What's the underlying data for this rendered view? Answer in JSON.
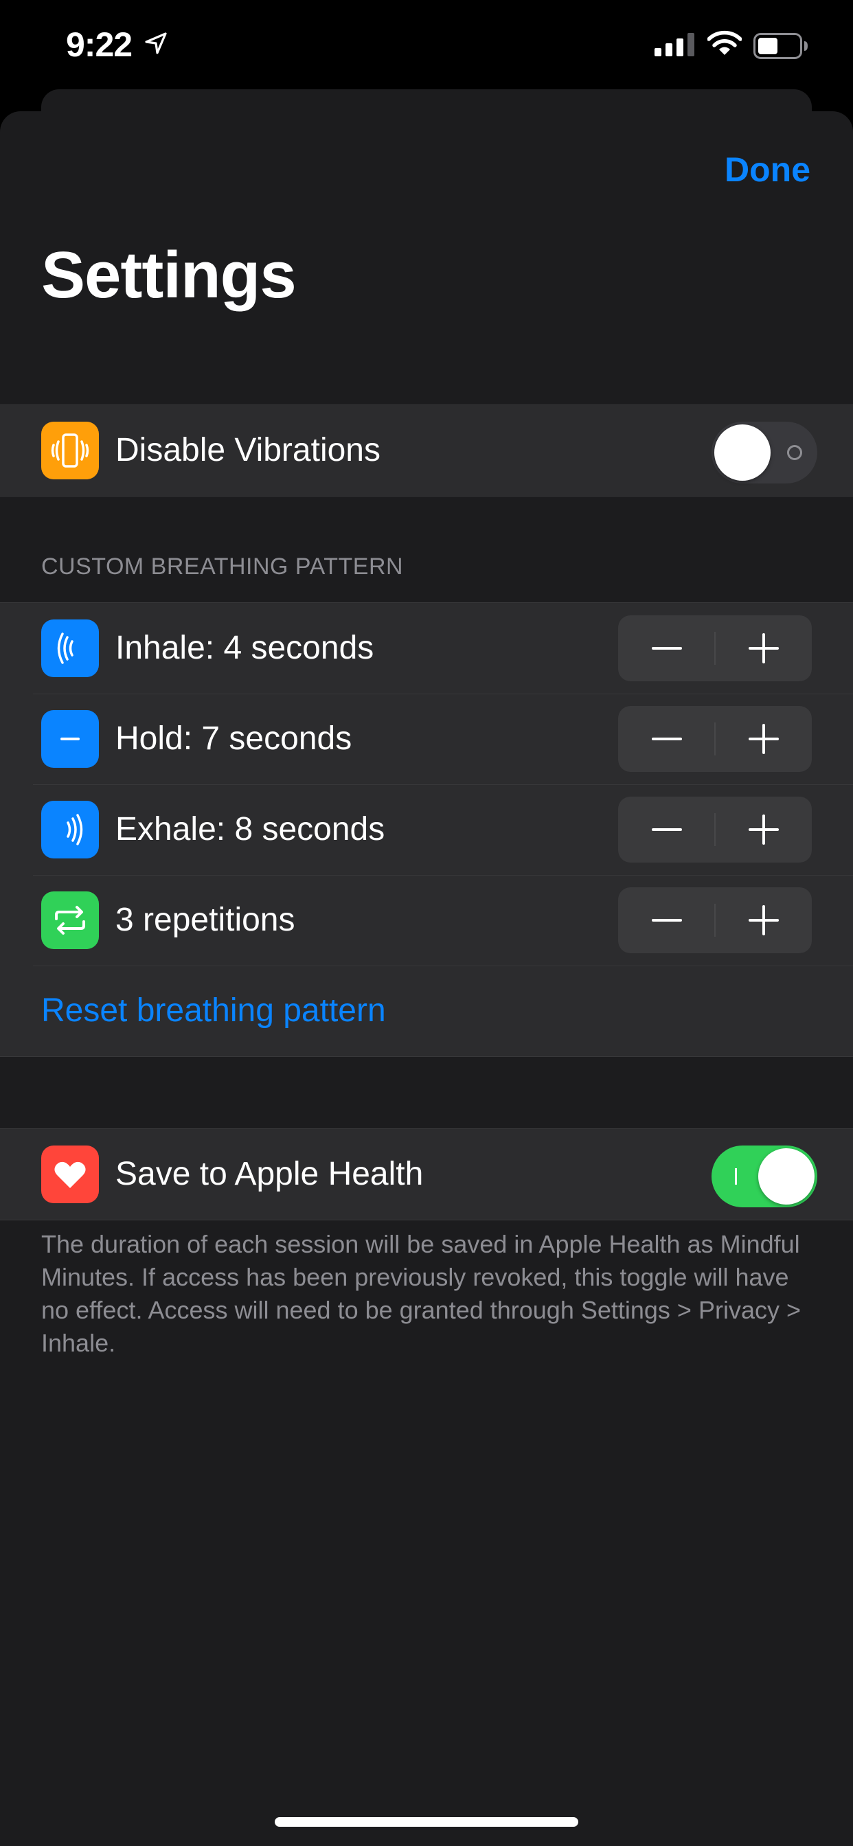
{
  "status_bar": {
    "time": "9:22",
    "icons": [
      "location-arrow-icon",
      "cellular-signal-icon",
      "wifi-icon",
      "battery-icon"
    ]
  },
  "nav": {
    "done_label": "Done",
    "title": "Settings"
  },
  "vibration": {
    "label": "Disable Vibrations",
    "icon": "phone-vibrate-icon",
    "enabled": false
  },
  "custom_pattern": {
    "header": "CUSTOM BREATHING PATTERN",
    "rows": [
      {
        "label": "Inhale: 4 seconds",
        "icon": "inhale-waves-icon"
      },
      {
        "label": "Hold: 7 seconds",
        "icon": "hold-dash-icon"
      },
      {
        "label": "Exhale: 8 seconds",
        "icon": "exhale-waves-icon"
      },
      {
        "label": "3 repetitions",
        "icon": "repeat-icon"
      }
    ],
    "reset_label": "Reset breathing pattern"
  },
  "health": {
    "label": "Save to Apple Health",
    "icon": "heart-icon",
    "enabled": true,
    "footer": "The duration of each session will be saved in Apple Health as Mindful Minutes. If access has been previously revoked, this toggle will have no effect. Access will need to be granted through Settings > Privacy > Inhale."
  },
  "colors": {
    "accent": "#0a84ff",
    "orange": "#ff9f0a",
    "green": "#30d158",
    "red": "#ff453a",
    "background": "#1c1c1e",
    "cell": "#2c2c2e"
  }
}
